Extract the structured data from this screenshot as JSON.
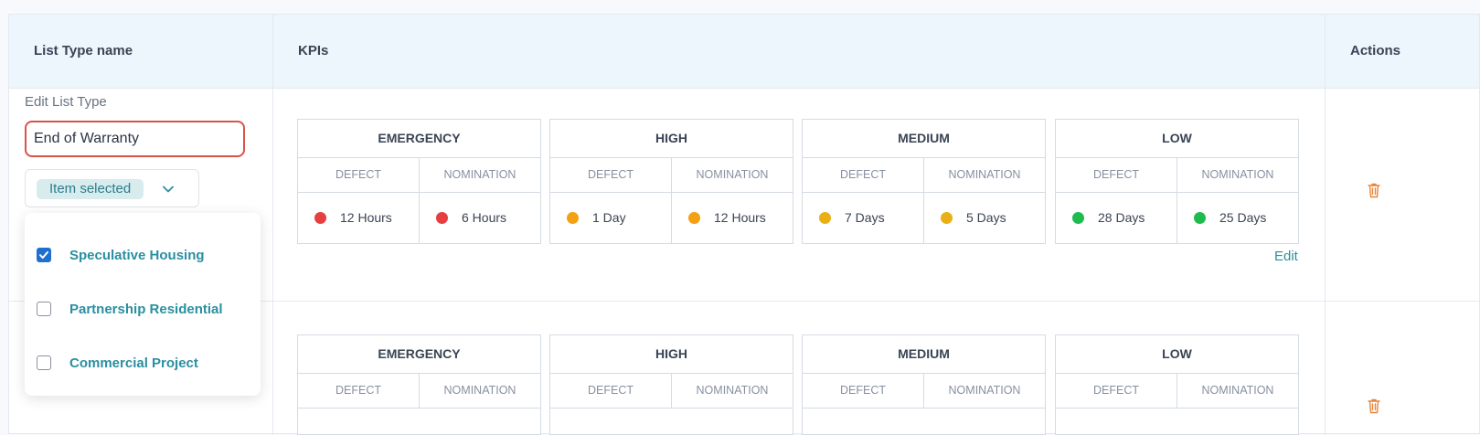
{
  "table": {
    "headers": {
      "list_type": "List Type name",
      "kpis": "KPIs",
      "actions": "Actions"
    }
  },
  "edit_form": {
    "label": "Edit List Type",
    "name_value": "End of Warranty",
    "multiselect_value": "Item selected",
    "options": [
      {
        "label": "Speculative Housing",
        "checked": true
      },
      {
        "label": "Partnership Residential",
        "checked": false
      },
      {
        "label": "Commercial Project",
        "checked": false
      }
    ]
  },
  "kpi_row1": [
    {
      "name": "EMERGENCY",
      "defect_label": "DEFECT",
      "nomination_label": "NOMINATION",
      "defect": "12 Hours",
      "nomination": "6 Hours",
      "color": "#e5403f"
    },
    {
      "name": "HIGH",
      "defect_label": "DEFECT",
      "nomination_label": "NOMINATION",
      "defect": "1 Day",
      "nomination": "12 Hours",
      "color": "#f3a013"
    },
    {
      "name": "MEDIUM",
      "defect_label": "DEFECT",
      "nomination_label": "NOMINATION",
      "defect": "7 Days",
      "nomination": "5 Days",
      "color": "#e9b016"
    },
    {
      "name": "LOW",
      "defect_label": "DEFECT",
      "nomination_label": "NOMINATION",
      "defect": "28 Days",
      "nomination": "25 Days",
      "color": "#1fbb4f"
    }
  ],
  "kpi_row2": [
    {
      "name": "EMERGENCY",
      "defect_label": "DEFECT",
      "nomination_label": "NOMINATION"
    },
    {
      "name": "HIGH",
      "defect_label": "DEFECT",
      "nomination_label": "NOMINATION"
    },
    {
      "name": "MEDIUM",
      "defect_label": "DEFECT",
      "nomination_label": "NOMINATION"
    },
    {
      "name": "LOW",
      "defect_label": "DEFECT",
      "nomination_label": "NOMINATION"
    }
  ],
  "edit_link": "Edit",
  "icons": {
    "delete": "trash-icon",
    "dropdown": "chevron-down-icon",
    "check": "check-icon"
  },
  "colors": {
    "accent": "#2a8fa0",
    "danger_outline": "#d9534a",
    "trash": "#e8833a",
    "checkbox": "#1f6fd1"
  }
}
